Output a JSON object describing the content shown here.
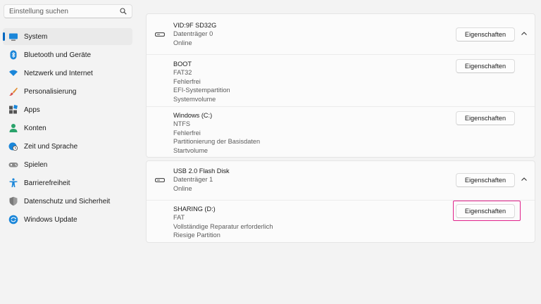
{
  "search": {
    "placeholder": "Einstellung suchen"
  },
  "sidebar": {
    "items": [
      {
        "label": "System",
        "icon": "monitor-icon"
      },
      {
        "label": "Bluetooth und Geräte",
        "icon": "bluetooth-icon"
      },
      {
        "label": "Netzwerk und Internet",
        "icon": "wifi-icon"
      },
      {
        "label": "Personalisierung",
        "icon": "brush-icon"
      },
      {
        "label": "Apps",
        "icon": "apps-icon"
      },
      {
        "label": "Konten",
        "icon": "person-icon"
      },
      {
        "label": "Zeit und Sprache",
        "icon": "globe-clock-icon"
      },
      {
        "label": "Spielen",
        "icon": "gamepad-icon"
      },
      {
        "label": "Barrierefreiheit",
        "icon": "accessibility-icon"
      },
      {
        "label": "Datenschutz und Sicherheit",
        "icon": "shield-icon"
      },
      {
        "label": "Windows Update",
        "icon": "update-icon"
      }
    ]
  },
  "disks": [
    {
      "header": {
        "lines": [
          "VID:9F SD32G",
          "Datenträger 0",
          "Online"
        ],
        "button": "Eigenschaften"
      },
      "partitions": [
        {
          "lines": [
            "BOOT",
            "FAT32",
            "Fehlerfrei",
            "EFI-Systempartition",
            "Systemvolume"
          ],
          "button": "Eigenschaften"
        },
        {
          "lines": [
            "Windows (C:)",
            "NTFS",
            "Fehlerfrei",
            "Partitionierung der Basisdaten",
            "Startvolume"
          ],
          "button": "Eigenschaften"
        }
      ]
    },
    {
      "header": {
        "lines": [
          "USB 2.0 Flash Disk",
          "Datenträger 1",
          "Online"
        ],
        "button": "Eigenschaften"
      },
      "partitions": [
        {
          "lines": [
            "SHARING (D:)",
            "FAT",
            "Vollständige Reparatur erforderlich",
            "Riesige Partition"
          ],
          "button": "Eigenschaften"
        }
      ]
    }
  ],
  "colors": {
    "accent": "#0067c0",
    "highlight": "#e0218a"
  }
}
